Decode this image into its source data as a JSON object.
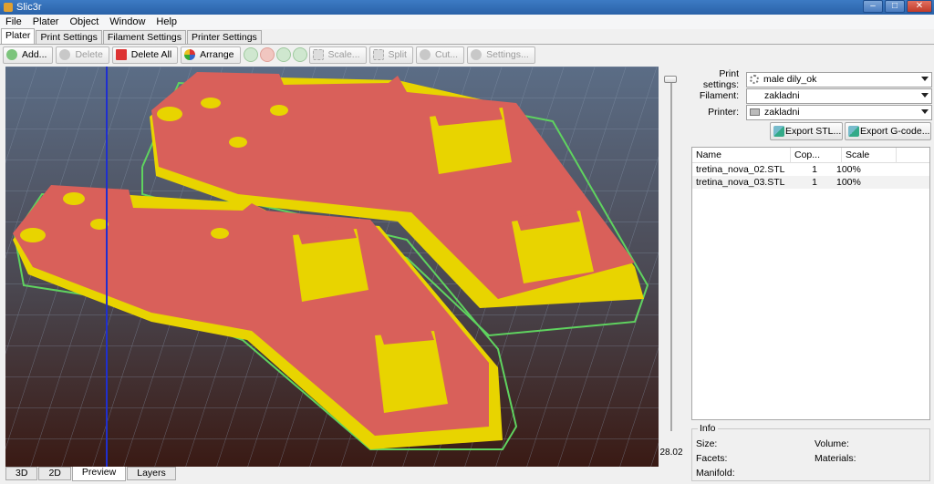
{
  "window": {
    "title": "Slic3r",
    "minimize": "–",
    "maximize": "□",
    "close": "✕"
  },
  "menu": [
    "File",
    "Plater",
    "Object",
    "Window",
    "Help"
  ],
  "tabs": [
    "Plater",
    "Print Settings",
    "Filament Settings",
    "Printer Settings"
  ],
  "toolbar": {
    "add": "Add...",
    "delete": "Delete",
    "delete_all": "Delete All",
    "arrange": "Arrange",
    "scale": "Scale...",
    "split": "Split",
    "cut": "Cut...",
    "settings": "Settings..."
  },
  "viewport": {
    "layer_height_value": "28.02"
  },
  "bottom_tabs": [
    "3D",
    "2D",
    "Preview",
    "Layers"
  ],
  "right": {
    "print_settings_label": "Print settings:",
    "print_settings_value": "male dily_ok",
    "filament_label": "Filament:",
    "filament_value": "zakladni",
    "printer_label": "Printer:",
    "printer_value": "zakladni",
    "export_stl": "Export STL...",
    "export_gcode": "Export G-code..."
  },
  "object_list": {
    "headers": [
      "Name",
      "Cop...",
      "Scale"
    ],
    "rows": [
      {
        "name": "tretina_nova_02.STL",
        "copies": "1",
        "scale": "100%"
      },
      {
        "name": "tretina_nova_03.STL",
        "copies": "1",
        "scale": "100%"
      }
    ]
  },
  "info": {
    "title": "Info",
    "size": "Size:",
    "volume": "Volume:",
    "facets": "Facets:",
    "materials": "Materials:",
    "manifold": "Manifold:"
  },
  "colors": {
    "model_top": "#d9605a",
    "model_wall": "#e8d400",
    "skirt": "#5fd35f",
    "cursor_line": "#1f2fd0"
  }
}
